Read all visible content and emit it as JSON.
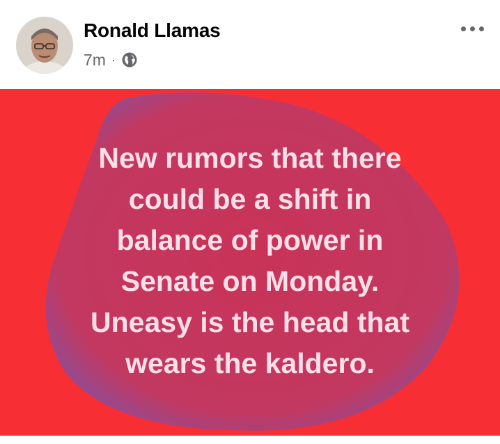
{
  "post": {
    "author": "Ronald Llamas",
    "time": "7m",
    "separator": "·",
    "audience_icon": "globe-icon",
    "more_icon": "more-options-icon",
    "status_lines": [
      "New rumors that there",
      "could be a shift in",
      "balance of power in",
      "Senate on Monday.",
      "Uneasy is the head that",
      "wears the kaldero."
    ]
  },
  "colors": {
    "card_background": "#f72f35",
    "blob": "#c8355a",
    "text": "#fcdfe8",
    "author": "#050505",
    "meta": "#65676b"
  }
}
